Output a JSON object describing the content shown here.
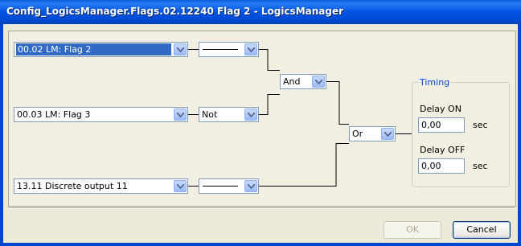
{
  "window": {
    "title": "Config_LogicsManager.Flags.02.12240 Flag 2 - LogicsManager"
  },
  "inputs": [
    {
      "value": "00.02 LM: Flag 2",
      "operator": ""
    },
    {
      "value": "00.03 LM: Flag 3",
      "operator": "Not"
    },
    {
      "value": "13.11 Discrete output 11",
      "operator": ""
    }
  ],
  "gates": {
    "first": "And",
    "second": "Or"
  },
  "timing": {
    "group_label": "Timing",
    "delay_on_label": "Delay ON",
    "delay_on_value": "0,00",
    "delay_on_unit": "sec",
    "delay_off_label": "Delay OFF",
    "delay_off_value": "0,00",
    "delay_off_unit": "sec"
  },
  "buttons": {
    "ok": "OK",
    "cancel": "Cancel"
  },
  "colors": {
    "titlebar": "#0054e3",
    "selection": "#316ac5",
    "group_title": "#0046d5",
    "dialog_bg": "#ece9d8"
  }
}
